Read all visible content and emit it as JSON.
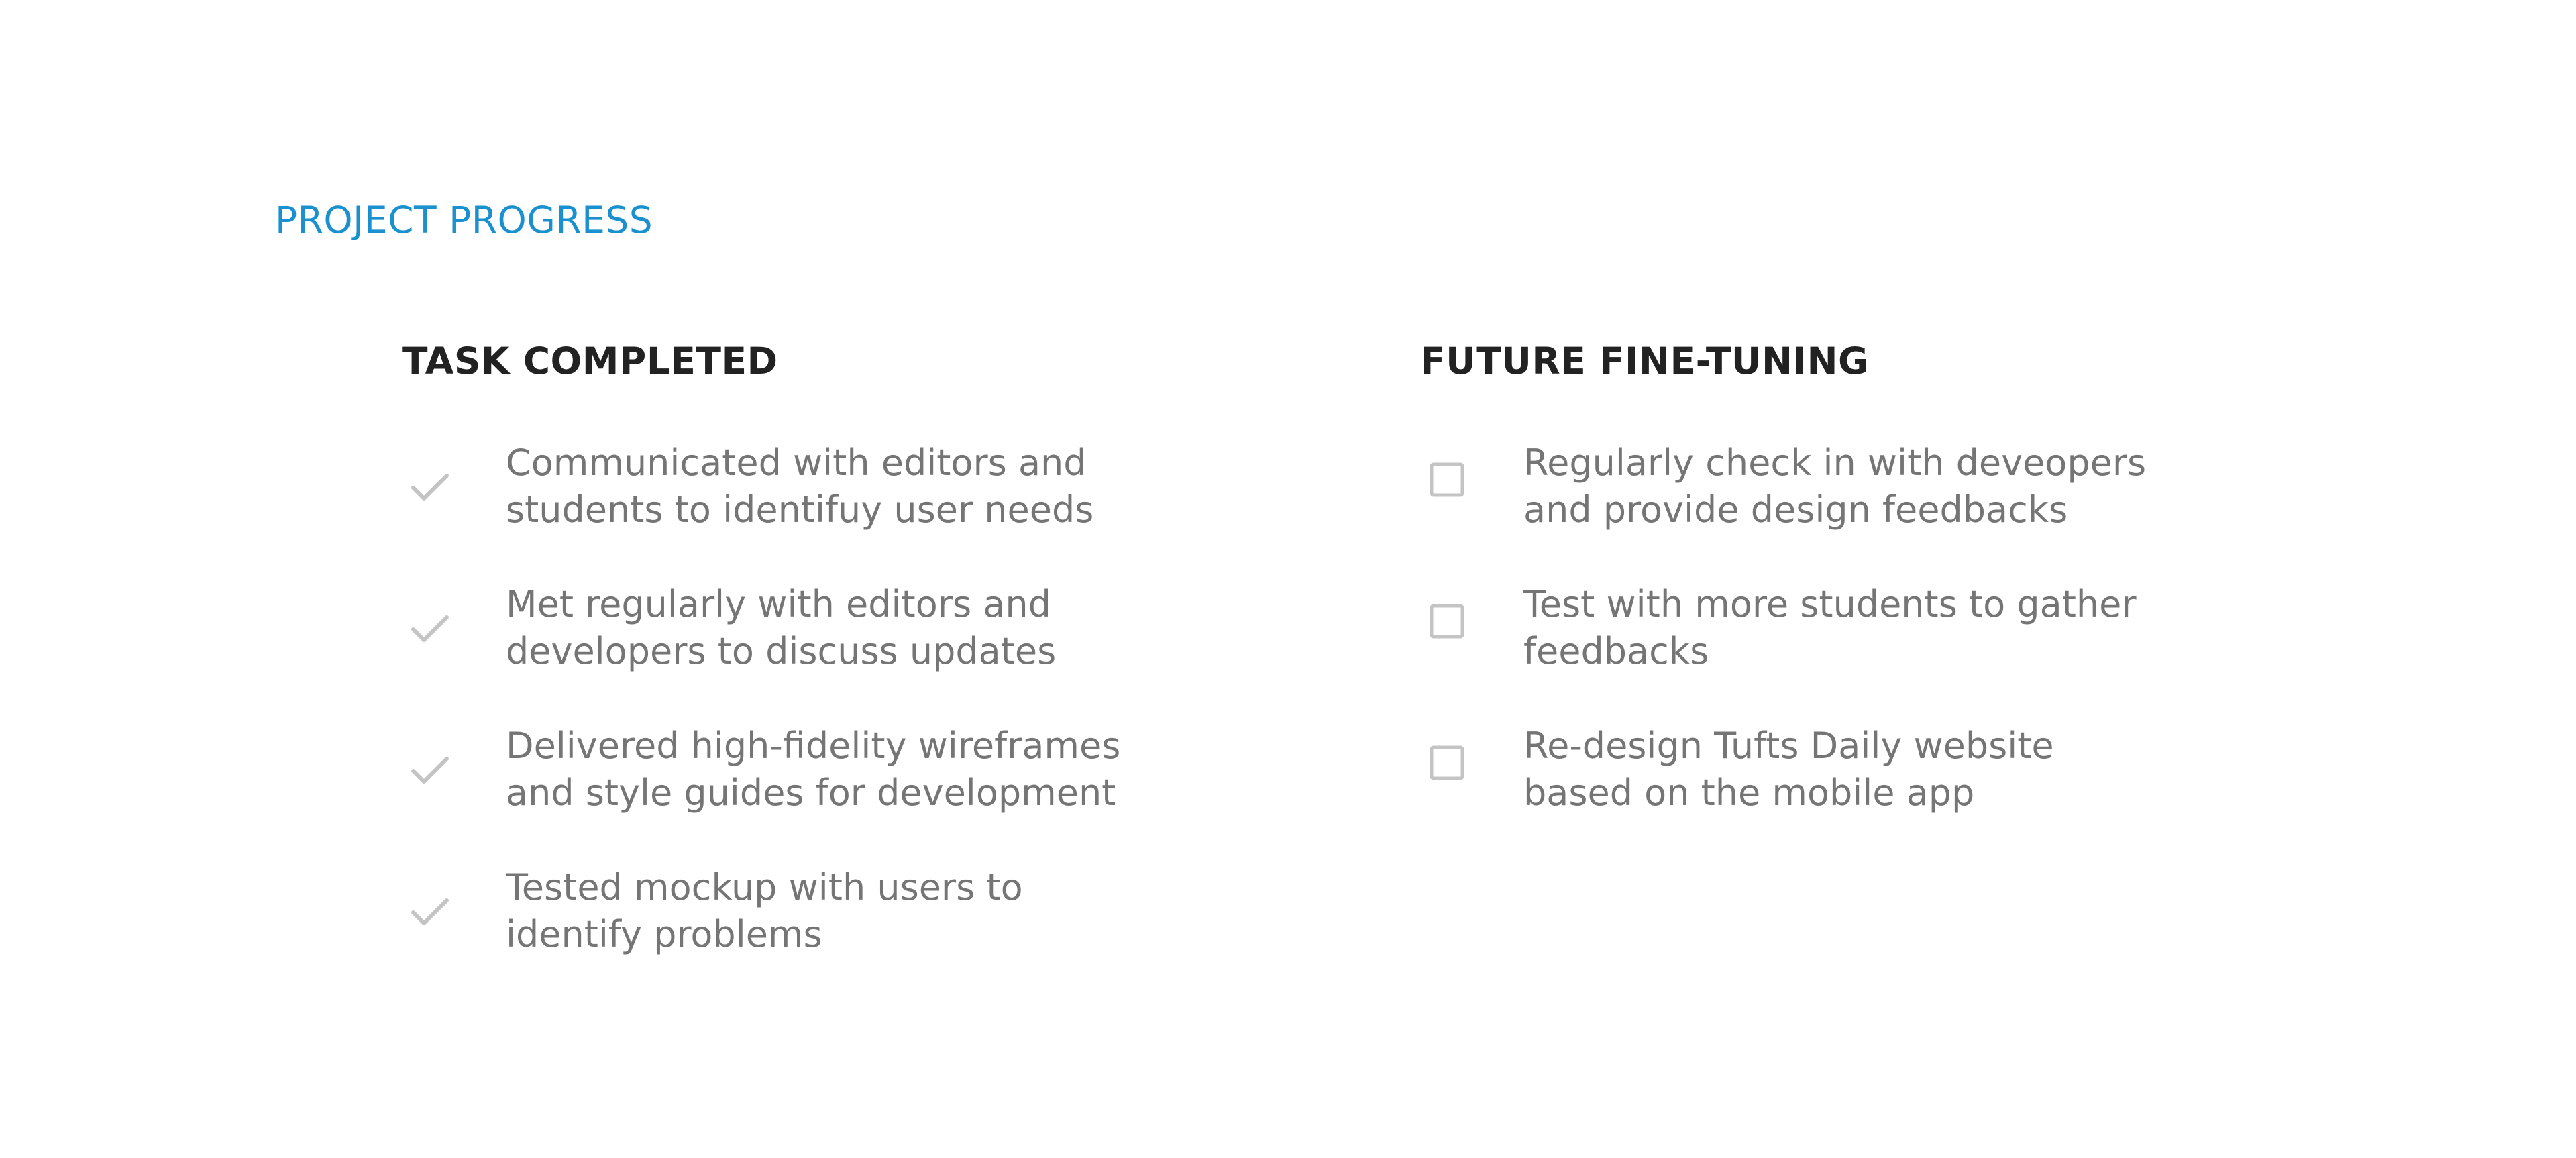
{
  "section": {
    "title": "PROJECT PROGRESS"
  },
  "completed": {
    "heading": "TASK COMPLETED",
    "icon": "check-icon",
    "items": [
      {
        "line1": "Communicated with editors and",
        "line2": "students to identifuy user needs"
      },
      {
        "line1": "Met regularly with editors and",
        "line2": "developers to discuss updates"
      },
      {
        "line1": "Delivered high-fidelity wireframes",
        "line2": "and style guides for development"
      },
      {
        "line1": "Tested mockup with users to",
        "line2": "identify problems"
      }
    ]
  },
  "future": {
    "heading": "FUTURE FINE-TUNING",
    "icon": "checkbox-icon",
    "items": [
      {
        "line1": "Regularly check in with deveopers",
        "line2": "and provide design feedbacks"
      },
      {
        "line1": "Test with more students to gather",
        "line2": "feedbacks"
      },
      {
        "line1": "Re-design Tufts Daily website",
        "line2": "based on the mobile app"
      }
    ]
  },
  "colors": {
    "accent": "#1a90cf",
    "heading": "#222222",
    "body_text": "#757575",
    "icon": "#c4c4c4"
  }
}
